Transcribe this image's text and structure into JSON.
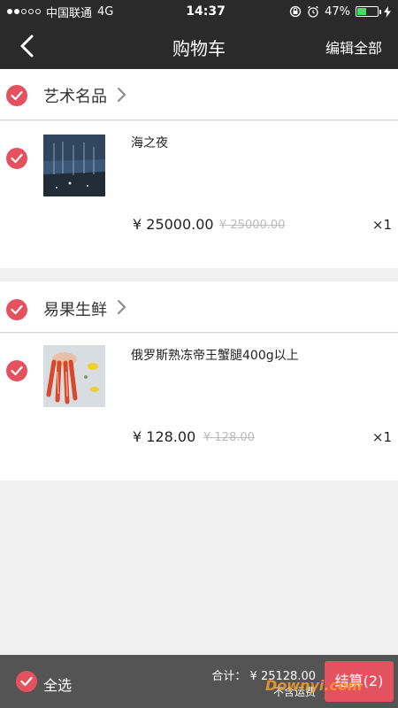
{
  "status_bar": {
    "carrier": "中国联通",
    "network": "4G",
    "time": "14:37",
    "battery_percent": "47%",
    "battery_level": 0.47
  },
  "nav": {
    "back_icon": "chevron-left-icon",
    "title": "购物车",
    "edit_label": "编辑全部"
  },
  "stores": [
    {
      "name": "艺术名品",
      "checked": true,
      "items": [
        {
          "title": "海之夜",
          "price": "¥ 25000.00",
          "original_price": "¥ 25000.00",
          "quantity": "×1",
          "checked": true
        }
      ]
    },
    {
      "name": "易果生鲜",
      "checked": true,
      "items": [
        {
          "title": "俄罗斯熟冻帝王蟹腿400g以上",
          "price": "¥ 128.00",
          "original_price": "¥ 128.00",
          "quantity": "×1",
          "checked": true
        }
      ]
    }
  ],
  "footer": {
    "select_all_label": "全选",
    "total": "合计： ¥ 25128.00",
    "shipping_note": "不含运费",
    "checkout_label": "结算(2)"
  },
  "colors": {
    "accent": "#e5525f",
    "topbar": "#2a2a2a",
    "bottombar": "#545454"
  },
  "watermark": "Downyi.com"
}
